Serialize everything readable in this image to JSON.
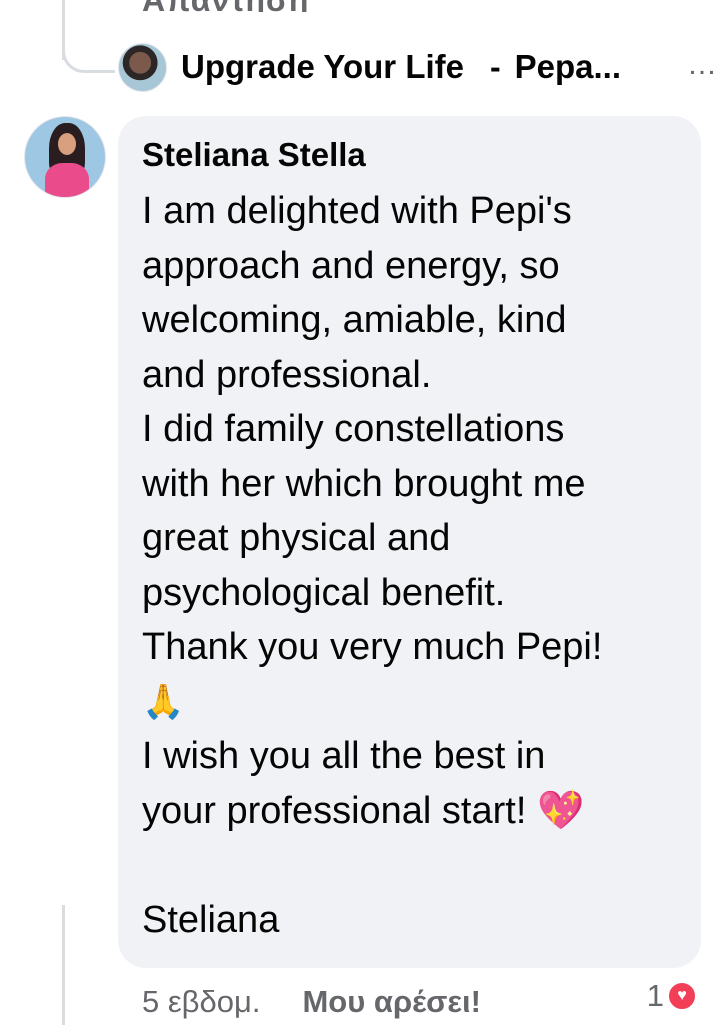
{
  "top_reply_label": "Απάντηση",
  "parent_comment": {
    "author": "Upgrade Your Life",
    "separator": "-",
    "page_name": "Pepa...",
    "more_icon": "more-dots-icon"
  },
  "comment": {
    "author": "Steliana Stella",
    "lines": [
      "I am delighted with Pepi's",
      "approach and energy, so",
      "welcoming, amiable, kind",
      "and professional.",
      "I did family constellations",
      "with her which brought me",
      "great physical and",
      "psychological benefit.",
      "Thank you very much Pepi!",
      "🙏",
      "I wish you all the best in",
      "your professional start! 💖",
      "",
      "Steliana"
    ]
  },
  "footer": {
    "timestamp": "5 εβδομ.",
    "like_label": "Μου αρέσει!",
    "reaction_count": "1",
    "reaction_icon": "heart-reaction-icon"
  },
  "colors": {
    "bubble": "#f0f2f5",
    "meta_text": "#65676b",
    "heart": "#f33e58"
  }
}
